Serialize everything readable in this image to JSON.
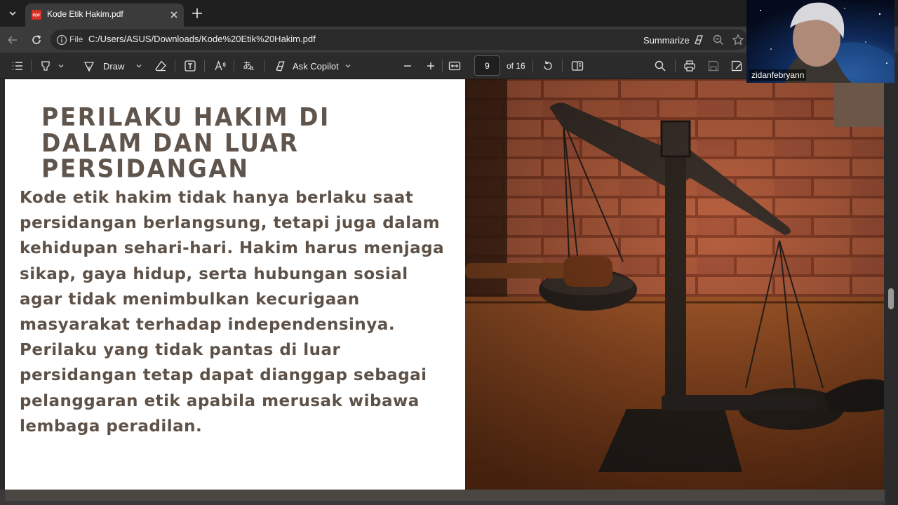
{
  "browser": {
    "tab": {
      "title": "Kode Etik Hakim.pdf"
    },
    "address": {
      "scheme_label": "File",
      "url": "C:/Users/ASUS/Downloads/Kode%20Etik%20Hakim.pdf",
      "summarize_label": "Summarize"
    }
  },
  "pdf_toolbar": {
    "draw_label": "Draw",
    "copilot_label": "Ask Copilot",
    "page_current": "9",
    "page_total": "of 16"
  },
  "slide": {
    "title": "PERILAKU HAKIM DI DALAM DAN LUAR PERSIDANGAN",
    "body": "Kode etik hakim tidak hanya berlaku saat persidangan berlangsung, tetapi juga dalam kehidupan sehari-hari. Hakim harus menjaga sikap, gaya hidup, serta hubungan sosial agar tidak menimbulkan kecurigaan masyarakat terhadap independensinya. Perilaku yang tidak pantas di luar persidangan tetap dapat dianggap sebagai pelanggaran etik apabila merusak wibawa lembaga peradilan."
  },
  "webcam": {
    "name": "zidanfebryann"
  },
  "colors": {
    "title": "#5f554c",
    "body": "#5e5248",
    "chrome_dark": "#1f1f1f",
    "chrome_mid": "#3b3b3b",
    "toolbar": "#2b2b2b"
  },
  "icons": [
    "tab-list-icon",
    "pdf-file-icon",
    "close-icon",
    "plus-icon",
    "back-icon",
    "refresh-icon",
    "info-icon",
    "copilot-icon",
    "zoom-icon",
    "favorite-icon",
    "contents-icon",
    "highlight-icon",
    "chevron-down-icon",
    "draw-icon",
    "eraser-icon",
    "text-box-icon",
    "read-aloud-icon",
    "translate-icon",
    "minus-icon",
    "fit-page-icon",
    "rotate-icon",
    "page-view-icon",
    "search-icon",
    "print-icon",
    "save-icon",
    "save-as-icon"
  ]
}
